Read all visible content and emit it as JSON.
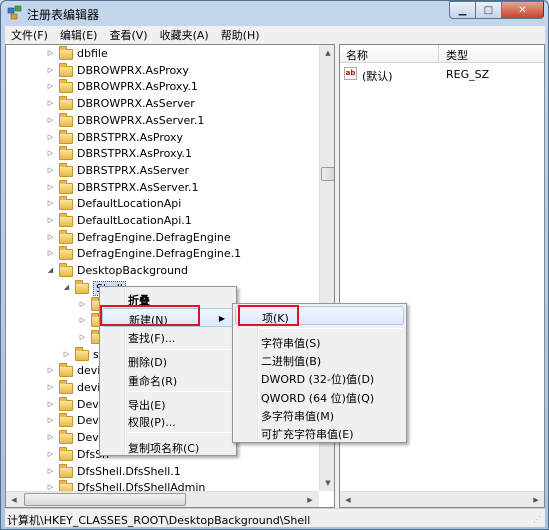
{
  "window": {
    "title": "注册表编辑器",
    "buttons": {
      "minimize": "▁",
      "maximize": "□",
      "close": "✕"
    }
  },
  "menubar": [
    "文件(F)",
    "编辑(E)",
    "查看(V)",
    "收藏夹(A)",
    "帮助(H)"
  ],
  "tree": [
    {
      "label": "dbfile",
      "expander": "▷"
    },
    {
      "label": "DBROWPRX.AsProxy",
      "expander": "▷"
    },
    {
      "label": "DBROWPRX.AsProxy.1",
      "expander": "▷"
    },
    {
      "label": "DBROWPRX.AsServer",
      "expander": "▷"
    },
    {
      "label": "DBROWPRX.AsServer.1",
      "expander": "▷"
    },
    {
      "label": "DBRSTPRX.AsProxy",
      "expander": "▷"
    },
    {
      "label": "DBRSTPRX.AsProxy.1",
      "expander": "▷"
    },
    {
      "label": "DBRSTPRX.AsServer",
      "expander": "▷"
    },
    {
      "label": "DBRSTPRX.AsServer.1",
      "expander": "▷"
    },
    {
      "label": "DefaultLocationApi",
      "expander": "▷"
    },
    {
      "label": "DefaultLocationApi.1",
      "expander": "▷"
    },
    {
      "label": "DefragEngine.DefragEngine",
      "expander": "▷"
    },
    {
      "label": "DefragEngine.DefragEngine.1",
      "expander": "▷"
    },
    {
      "label": "DesktopBackground",
      "expander": "◢"
    },
    {
      "label": "Shell",
      "expander": "◢"
    },
    {
      "label": "",
      "expander": "▷"
    },
    {
      "label": "",
      "expander": "▷"
    },
    {
      "label": "",
      "expander": "▷"
    },
    {
      "label": "sh",
      "expander": "▷"
    },
    {
      "label": "devic",
      "expander": "▷"
    },
    {
      "label": "devic",
      "expander": "▷"
    },
    {
      "label": "Devic",
      "expander": "▷"
    },
    {
      "label": "Devic",
      "expander": "▷"
    },
    {
      "label": "Devic",
      "expander": "▷"
    },
    {
      "label": "DfsSh",
      "expander": "▷"
    },
    {
      "label": "DfsShell.DfsShell.1",
      "expander": "▷"
    },
    {
      "label": "DfsShell.DfsShellAdmin",
      "expander": "▷"
    }
  ],
  "list": {
    "headers": {
      "name": "名称",
      "type": "类型"
    },
    "rows": [
      {
        "icon": "ab",
        "name": "(默认)",
        "type": "REG_SZ"
      }
    ]
  },
  "status": "计算机\\HKEY_CLASSES_ROOT\\DesktopBackground\\Shell",
  "context_menu": {
    "collapse": "折叠",
    "new": "新建(N)",
    "find": "查找(F)...",
    "delete": "删除(D)",
    "rename": "重命名(R)",
    "export": "导出(E)",
    "permissions": "权限(P)...",
    "copy_key_name": "复制项名称(C)"
  },
  "submenu": {
    "key": "项(K)",
    "string_value": "字符串值(S)",
    "binary_value": "二进制值(B)",
    "dword_value": "DWORD (32-位)值(D)",
    "qword_value": "QWORD (64 位)值(Q)",
    "multi_string_value": "多字符串值(M)",
    "expandable_string_value": "可扩充字符串值(E)"
  },
  "colors": {
    "highlight_box": "#e0141e",
    "hover": "#dce9f9"
  }
}
